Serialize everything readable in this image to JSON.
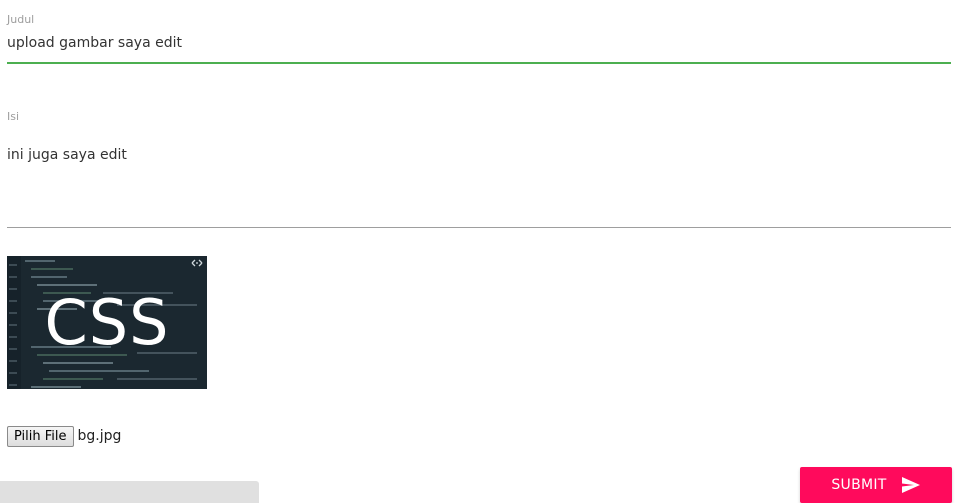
{
  "form": {
    "judul": {
      "label": "Judul",
      "value": "upload gambar saya edit"
    },
    "isi": {
      "label": "Isi",
      "value": "ini juga saya edit"
    },
    "image_preview": {
      "text": "CSS",
      "background": "#1c2a33"
    },
    "file_input": {
      "button_label": "Pilih File",
      "file_name": "bg.jpg"
    },
    "submit": {
      "label": "SUBMIT",
      "icon": "send-icon",
      "color": "#ff0a5c"
    }
  },
  "colors": {
    "active_underline": "#4caf50",
    "inactive_underline": "#9e9e9e"
  }
}
